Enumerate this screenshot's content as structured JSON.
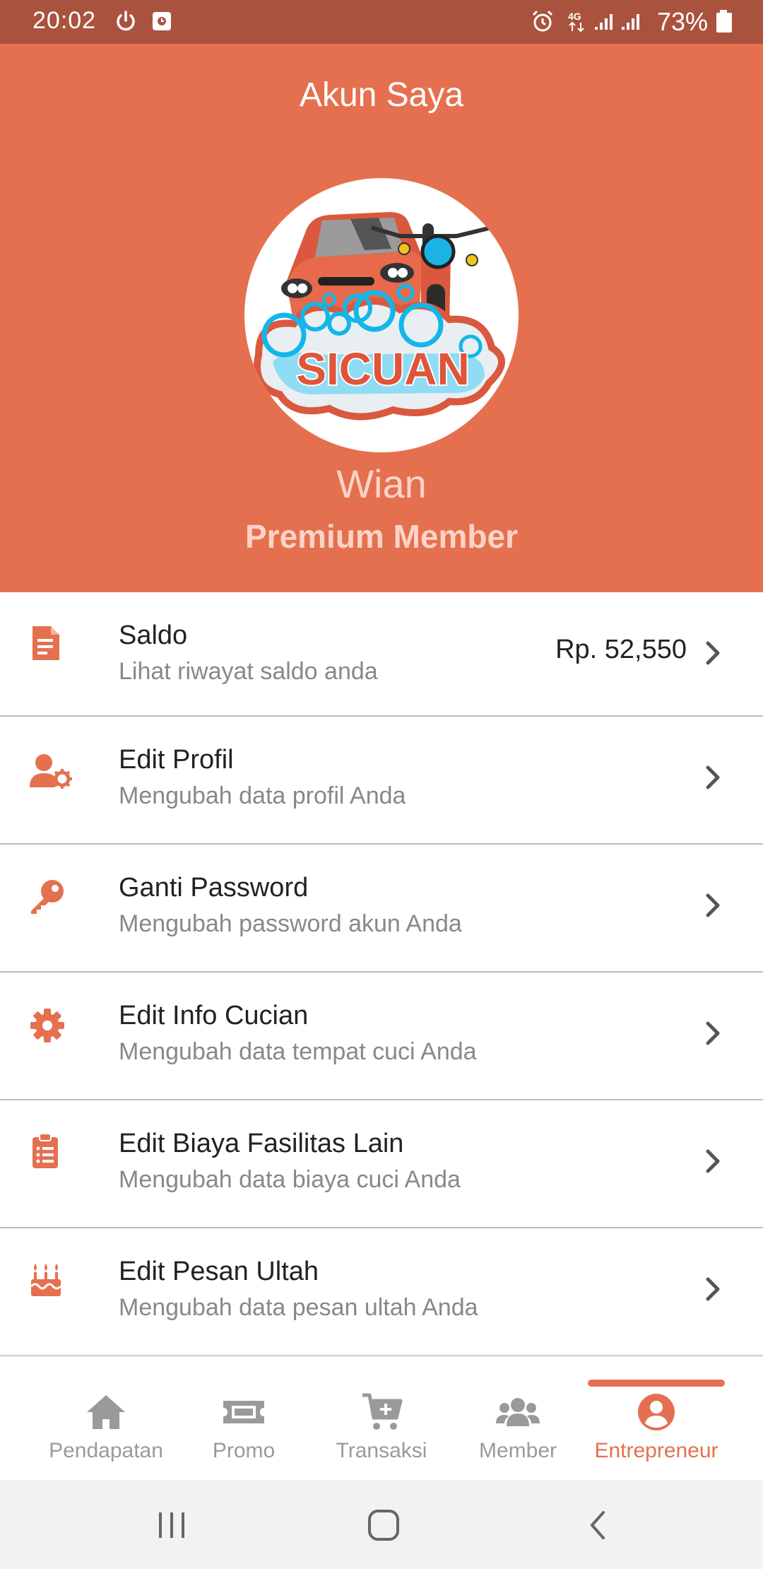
{
  "status_bar": {
    "time": "20:02",
    "battery": "73%",
    "icons": [
      "power-icon",
      "screen-record-icon",
      "alarm-icon",
      "4g-icon",
      "signal-icon",
      "signal-icon",
      "battery-icon"
    ]
  },
  "header": {
    "title": "Akun Saya",
    "logo_text": "SICUAN",
    "user_name": "Wian",
    "member_type": "Premium Member"
  },
  "menu": {
    "items": [
      {
        "icon": "document-icon",
        "title": "Saldo",
        "subtitle": "Lihat riwayat saldo anda",
        "value": "Rp. 52,550"
      },
      {
        "icon": "user-gear-icon",
        "title": "Edit Profil",
        "subtitle": "Mengubah data profil Anda"
      },
      {
        "icon": "key-icon",
        "title": "Ganti Password",
        "subtitle": "Mengubah password akun Anda"
      },
      {
        "icon": "gear-icon",
        "title": "Edit Info Cucian",
        "subtitle": "Mengubah data tempat cuci Anda"
      },
      {
        "icon": "clipboard-list-icon",
        "title": "Edit Biaya Fasilitas Lain",
        "subtitle": "Mengubah data biaya cuci Anda"
      },
      {
        "icon": "birthday-cake-icon",
        "title": "Edit Pesan Ultah",
        "subtitle": "Mengubah data pesan ultah Anda"
      }
    ]
  },
  "bottom_nav": {
    "items": [
      {
        "icon": "home-icon",
        "label": "Pendapatan"
      },
      {
        "icon": "ticket-icon",
        "label": "Promo"
      },
      {
        "icon": "cart-plus-icon",
        "label": "Transaksi"
      },
      {
        "icon": "users-icon",
        "label": "Member"
      },
      {
        "icon": "user-circle-icon",
        "label": "Entrepreneur"
      }
    ],
    "active": "Entrepreneur"
  },
  "colors": {
    "accent": "#e5704f",
    "status_bar": "#a9533f",
    "name_text": "#fbd4c6",
    "inactive": "#9a9a9a"
  }
}
